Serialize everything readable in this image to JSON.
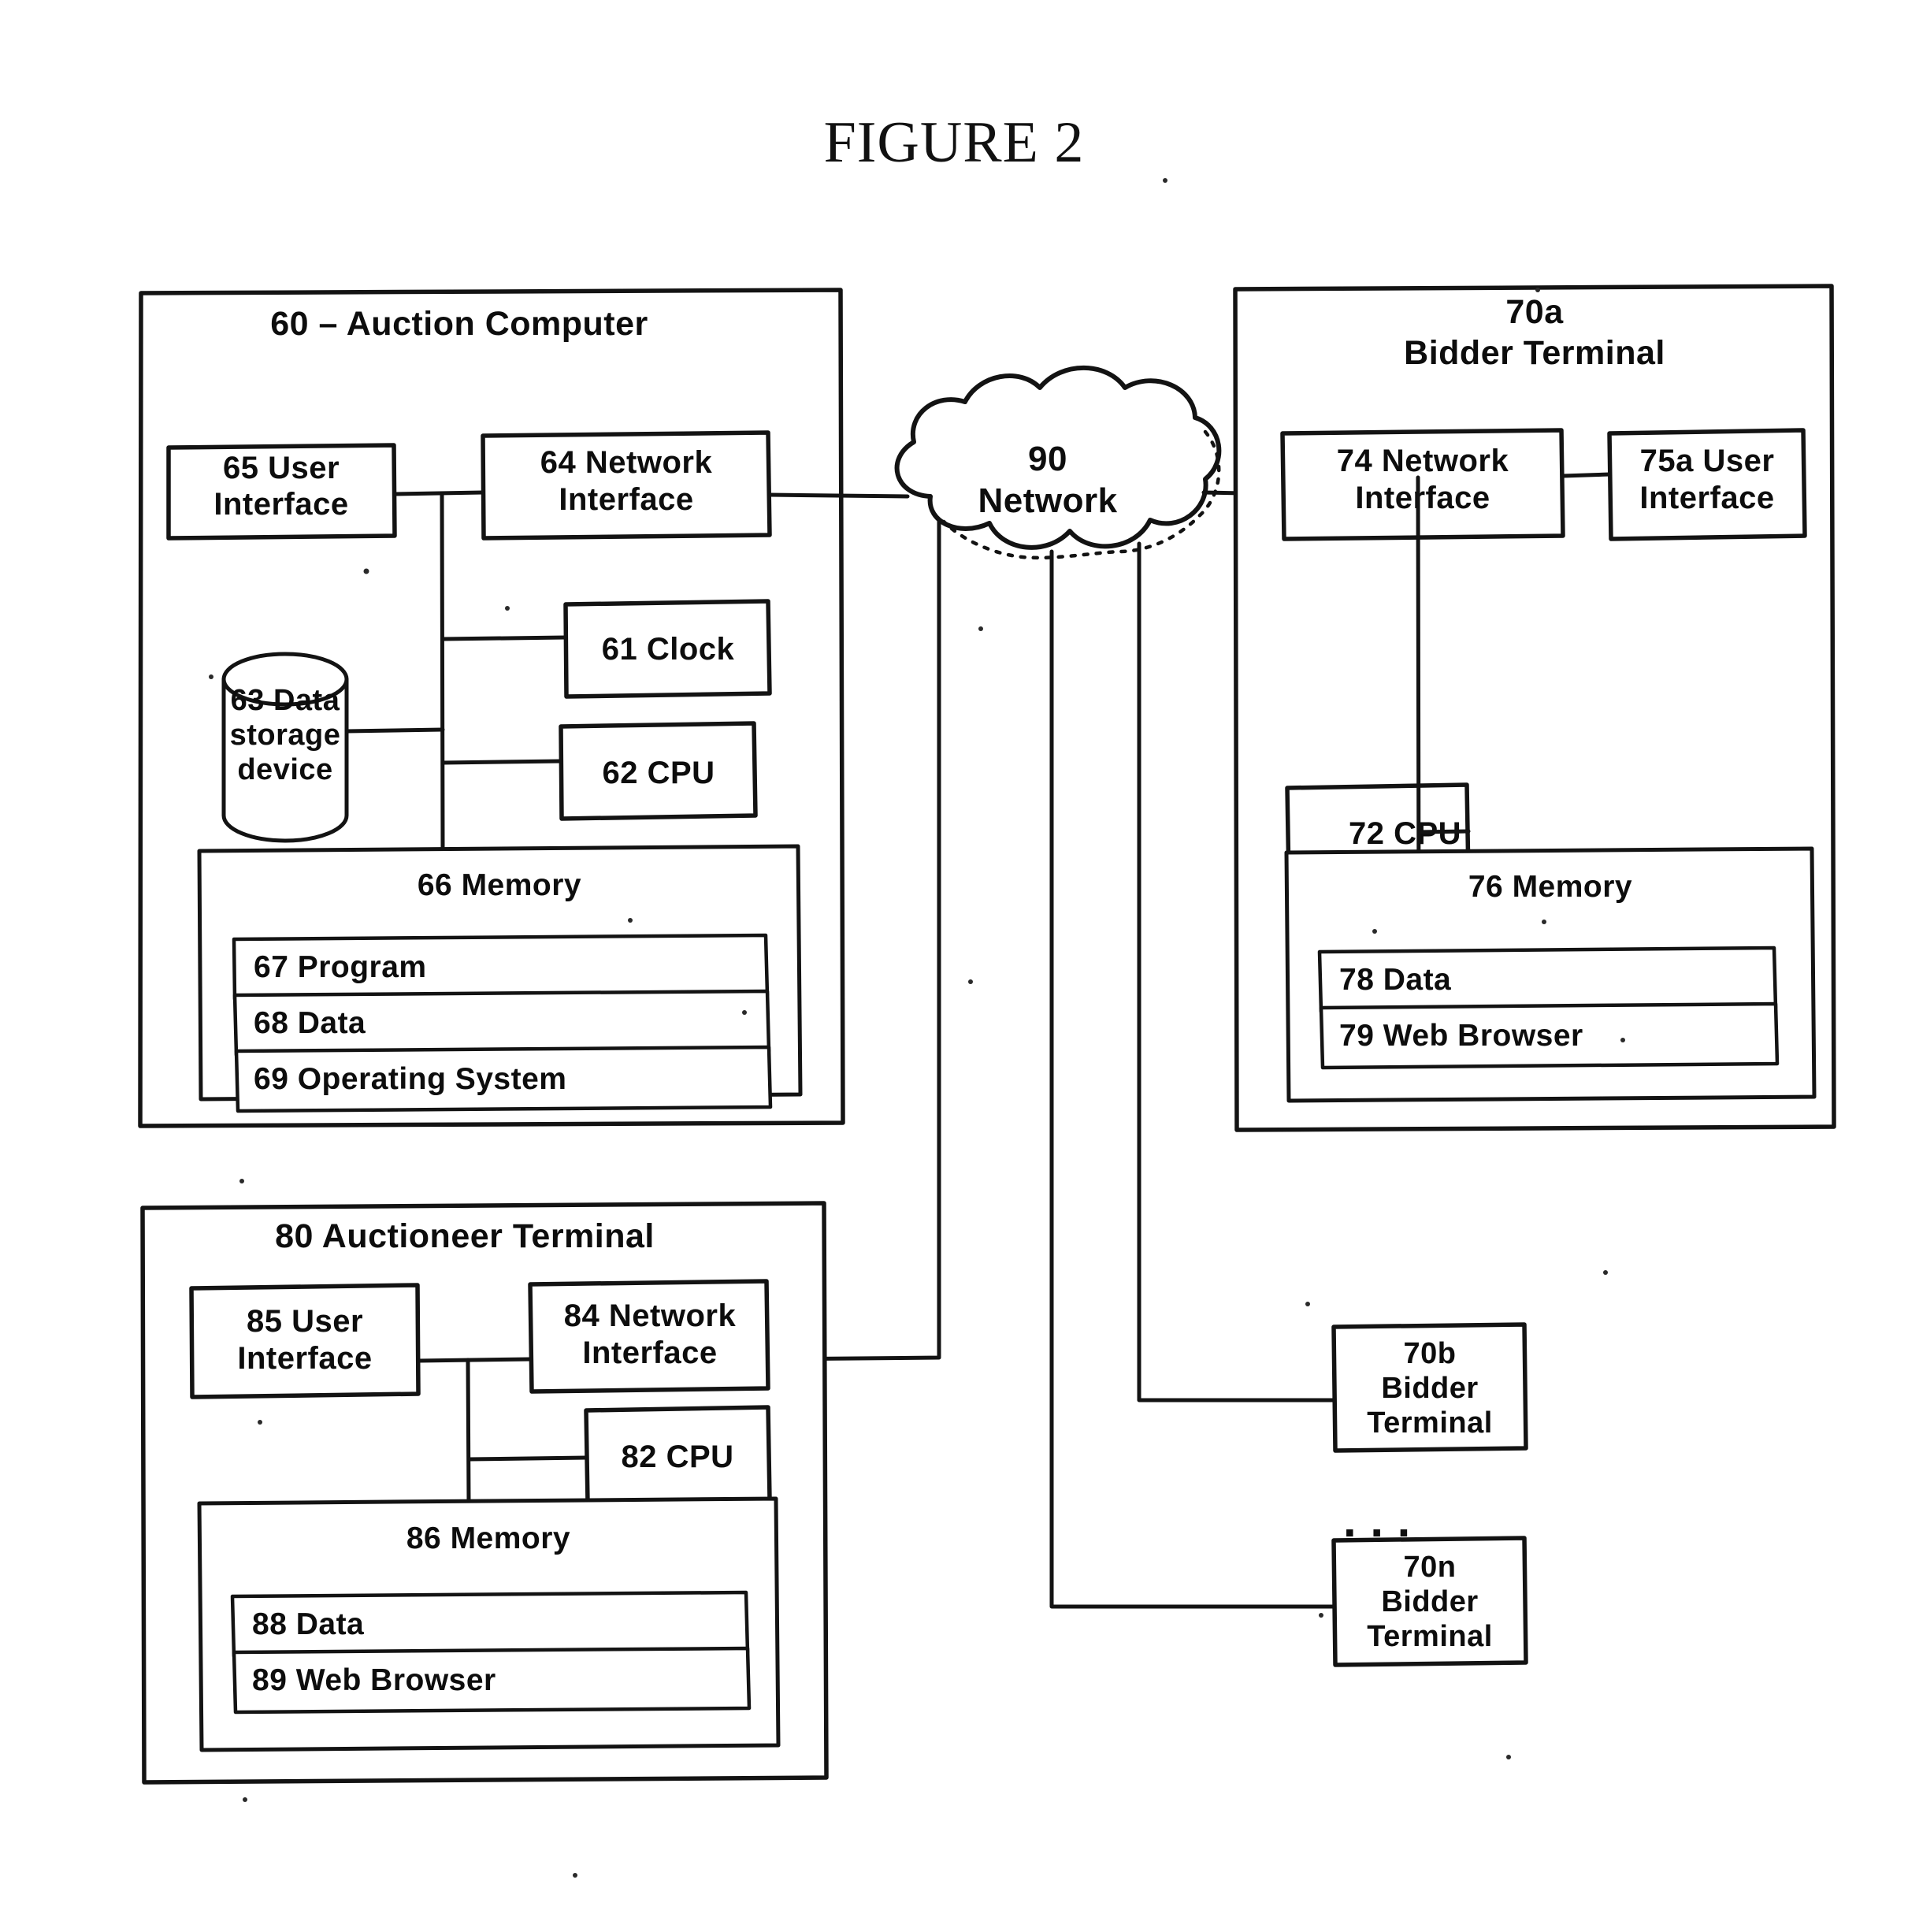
{
  "figure": {
    "title": "FIGURE 2"
  },
  "auction_computer": {
    "title": "60 – Auction Computer",
    "user_interface": "65 User\nInterface",
    "user_interface_line1": "65  User",
    "user_interface_line2": "Interface",
    "network_interface_line1": "64  Network",
    "network_interface_line2": "Interface",
    "clock": "61   Clock",
    "cpu": "62   CPU",
    "storage_line1": "63  Data",
    "storage_line2": "storage",
    "storage_line3": "device",
    "memory_title": "66  Memory",
    "memory_rows": [
      "67  Program",
      "68  Data",
      "69  Operating System"
    ]
  },
  "network": {
    "label_line1": "90",
    "label_line2": "Network"
  },
  "bidder_terminal_a": {
    "title_line1": "70a",
    "title_line2": "Bidder Terminal",
    "network_interface_line1": "74  Network",
    "network_interface_line2": "Interface",
    "user_interface_line1": "75a  User",
    "user_interface_line2": "Interface",
    "cpu": "72 CPU",
    "memory_title": "76 Memory",
    "memory_rows": [
      "78  Data",
      "79  Web Browser"
    ]
  },
  "auctioneer_terminal": {
    "title": "80  Auctioneer Terminal",
    "user_interface_line1": "85 User",
    "user_interface_line2": "Interface",
    "network_interface_line1": "84 Network",
    "network_interface_line2": "Interface",
    "cpu": "82 CPU",
    "memory_title": "86 Memory",
    "memory_rows": [
      "88  Data",
      "89  Web Browser"
    ]
  },
  "other_bidder_terminals": {
    "ellipsis": ". . .",
    "terminal_b": {
      "line1": "70b",
      "line2": "Bidder",
      "line3": "Terminal"
    },
    "terminal_n": {
      "line1": "70n",
      "line2": "Bidder",
      "line3": "Terminal"
    }
  },
  "colors": {
    "ink": "#131313",
    "paper": "#ffffff"
  }
}
